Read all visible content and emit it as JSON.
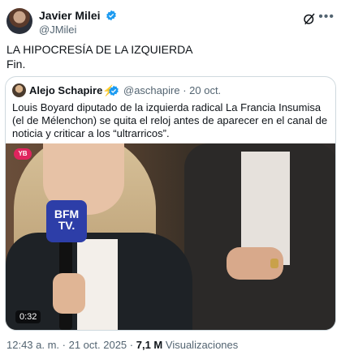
{
  "post": {
    "author_name": "Javier Milei",
    "author_handle": "@JMilei",
    "text_line1": "LA HIPOCRESÍA DE LA IZQUIERDA",
    "text_line2": "Fin.",
    "timestamp": "12:43 a. m. · 21 oct. 2025",
    "separator": "·",
    "views_count": "7,1 M",
    "views_label": "Visualizaciones"
  },
  "quote": {
    "author_name": "Alejo Schapire",
    "author_emoji": "⚡",
    "author_handle": "@aschapire",
    "date": "· 20 oct.",
    "text": "Louis Boyard diputado de la izquierda radical La Francia Insumisa (el de Mélenchon) se quita el reloj antes de aparecer en el canal de noticia y criticar a los “ultrarricos”.",
    "video": {
      "duration": "0:32",
      "mic_logo_line1": "BFM",
      "mic_logo_line2": "TV.",
      "corner_badge": "YB"
    }
  },
  "icons": [
    "verified-badge-icon",
    "grok-icon",
    "more-icon"
  ],
  "colors": {
    "verified": "#1d9bf0",
    "secondary_text": "#536471",
    "border": "#cfd9de"
  }
}
